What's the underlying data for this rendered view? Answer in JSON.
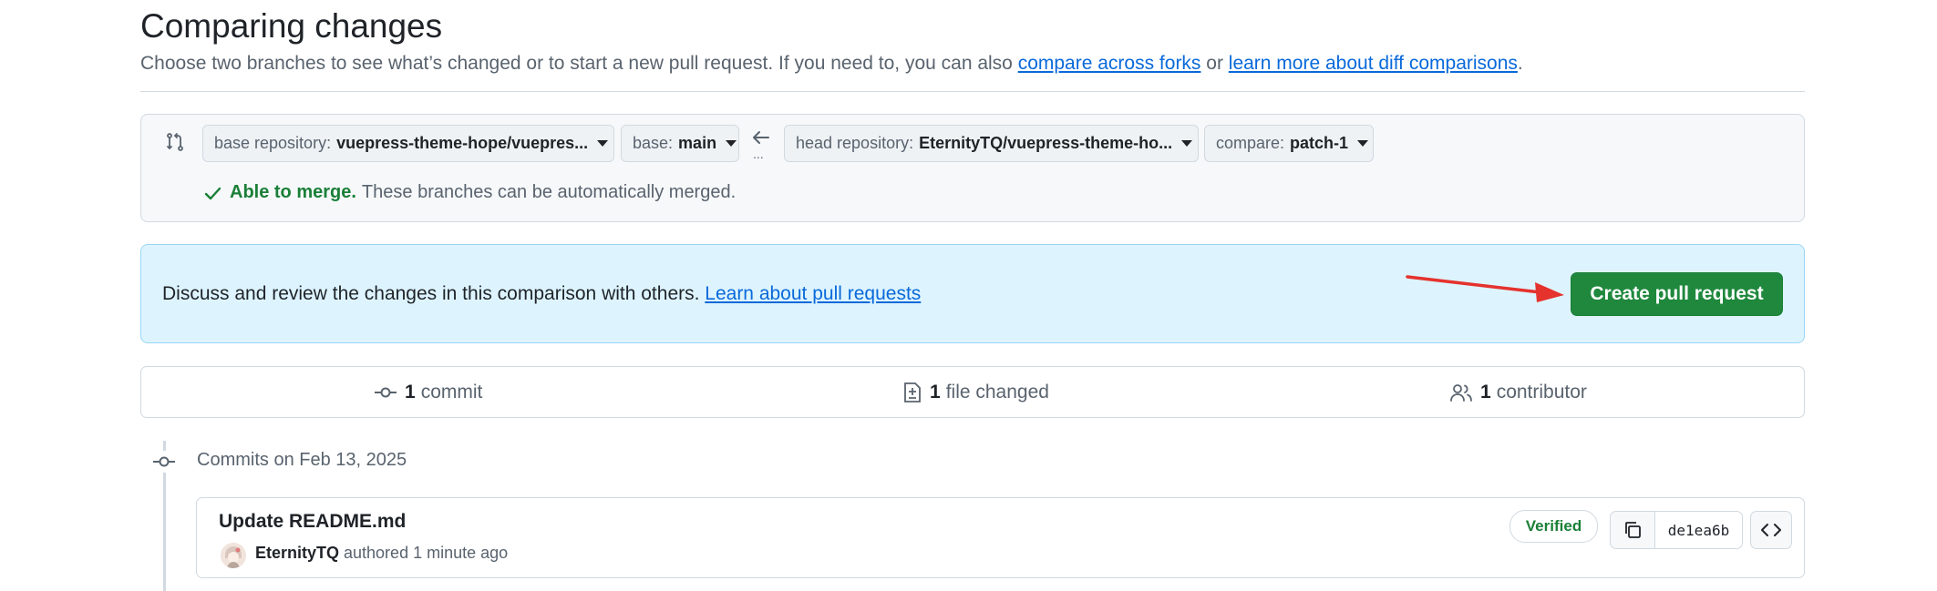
{
  "header": {
    "title": "Comparing changes",
    "subtitle_prefix": "Choose two branches to see what’s changed or to start a new pull request. If you need to, you can also ",
    "compare_forks_link": "compare across forks",
    "or_text": " or ",
    "learn_diff_link": "learn more about diff comparisons",
    "period": "."
  },
  "range": {
    "base_repo_label": "base repository:",
    "base_repo_value": "vuepress-theme-hope/vuepres...",
    "base_label": "base:",
    "base_value": "main",
    "head_repo_label": "head repository:",
    "head_repo_value": "EternityTQ/vuepress-theme-ho...",
    "compare_label": "compare:",
    "compare_value": "patch-1",
    "dots": "...",
    "merge_ok": "Able to merge.",
    "merge_text": "These branches can be automatically merged."
  },
  "flash": {
    "text": "Discuss and review the changes in this comparison with others. ",
    "link": "Learn about pull requests",
    "button": "Create pull request"
  },
  "stats": {
    "commits_count": "1",
    "commits_label": "commit",
    "files_count": "1",
    "files_label": "file changed",
    "contributors_count": "1",
    "contributors_label": "contributor"
  },
  "commits": {
    "date_heading": "Commits on Feb 13, 2025",
    "items": [
      {
        "title": "Update README.md",
        "author": "EternityTQ",
        "action": " authored 1 minute ago",
        "verified": "Verified",
        "sha": "de1ea6b"
      }
    ]
  },
  "colors": {
    "accent_link": "#0969da",
    "success_green": "#1f883d",
    "flash_bg": "#ddf4ff",
    "annotation_arrow": "#e5322d"
  }
}
